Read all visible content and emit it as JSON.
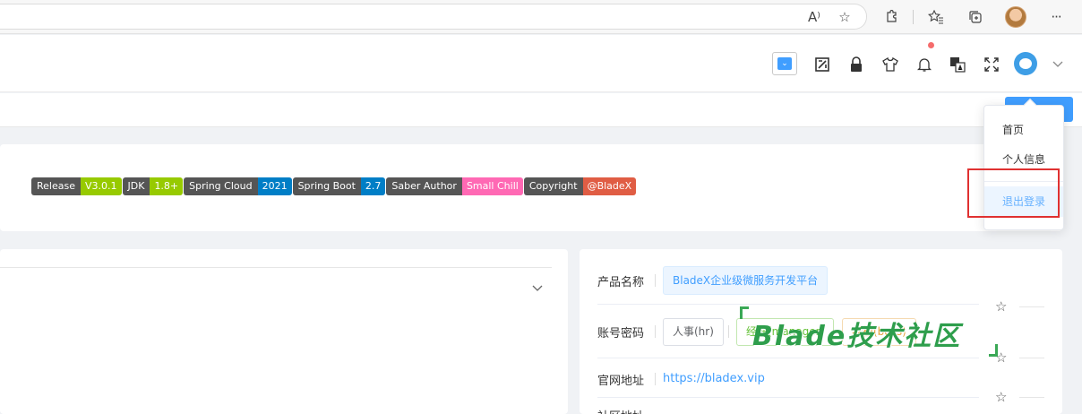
{
  "browser": {
    "icons": [
      "read-aloud-icon",
      "favorite-add-icon",
      "extensions-icon",
      "favorites-icon",
      "collections-icon",
      "profile-avatar",
      "more-icon"
    ],
    "read_aloud_glyph": "A⁾",
    "more_glyph": "···"
  },
  "header": {
    "icons": [
      "theme-select-icon",
      "screenshot-icon",
      "lock-icon",
      "theme-shirt-icon",
      "notification-bell-icon",
      "translate-icon",
      "fullscreen-icon",
      "user-avatar",
      "chevron-down-icon"
    ],
    "has_unread_notification": true
  },
  "banner": {
    "badges": [
      {
        "key": "Release",
        "value": "V3.0.1",
        "color": "#97ca00"
      },
      {
        "key": "JDK",
        "value": "1.8+",
        "color": "#97ca00"
      },
      {
        "key": "Spring Cloud",
        "value": "2021",
        "color": "#007ec6"
      },
      {
        "key": "Spring Boot",
        "value": "2.7",
        "color": "#007ec6"
      },
      {
        "key": "Saber Author",
        "value": "Small Chill",
        "color": "#ff69b4"
      },
      {
        "key": "Copyright",
        "value": "@BladeX",
        "color": "#e05d44"
      }
    ]
  },
  "info": {
    "product_label": "产品名称",
    "product_value": "BladeX企业级微服务开发平台",
    "account_label": "账号密码",
    "account_tags": [
      "人事(hr)",
      "经理(manager)",
      "老板(boss)"
    ],
    "website_label": "官网地址",
    "website_value": "https://bladex.vip",
    "next_label": "社区地址"
  },
  "watermark": "Blade技术社区",
  "dropdown": {
    "items": [
      "首页",
      "个人信息",
      "退出登录"
    ]
  },
  "colors": {
    "accent": "#409eff",
    "highlight": "#e03131",
    "watermark": "#2e9e4c"
  }
}
